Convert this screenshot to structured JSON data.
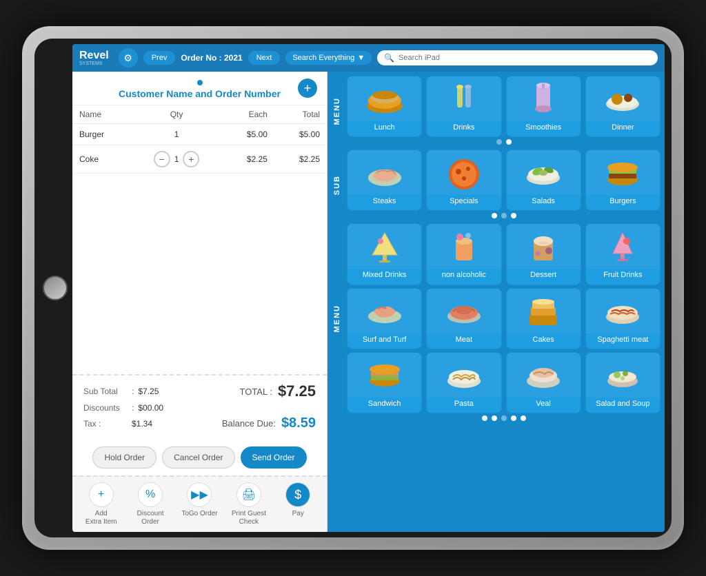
{
  "app": {
    "title": "Revel Systems POS"
  },
  "header": {
    "logo": "Revel",
    "logo_sub": "SYSTEMS",
    "gear_icon": "⚙",
    "prev_label": "Prev",
    "order_label": "Order No : 2021",
    "next_label": "Next",
    "search_dropdown": "Search Everything",
    "search_placeholder": "Search iPad"
  },
  "order": {
    "title": "Customer Name and Order Number",
    "add_button": "+",
    "table_headers": [
      "Name",
      "Qty",
      "Each",
      "Total"
    ],
    "items": [
      {
        "name": "Burger",
        "qty": "1",
        "each": "$5.00",
        "total": "$5.00"
      },
      {
        "name": "Coke",
        "qty": "1",
        "each": "$2.25",
        "total": "$2.25"
      }
    ],
    "subtotal_label": "Sub Total",
    "subtotal_value": "$7.25",
    "discounts_label": "Discounts",
    "discounts_value": "$00.00",
    "tax_label": "Tax :",
    "tax_value": "$1.34",
    "total_label": "TOTAL :",
    "total_value": "$7.25",
    "balance_label": "Balance Due:",
    "balance_value": "$8.59",
    "hold_label": "Hold Order",
    "cancel_label": "Cancel Order",
    "send_label": "Send Order"
  },
  "toolbar": {
    "items": [
      {
        "icon": "+",
        "label": "Add\nExtra Item"
      },
      {
        "icon": "%",
        "label": "Discount\nOrder"
      },
      {
        "icon": "▸▸",
        "label": "ToGo Order"
      },
      {
        "icon": "🖨",
        "label": "Print Guest\nCheck"
      },
      {
        "icon": "$",
        "label": "Pay",
        "is_pay": true
      }
    ]
  },
  "menu": {
    "sections": [
      {
        "label": "MENU",
        "items": [
          {
            "name": "Lunch",
            "emoji": "🍔"
          },
          {
            "name": "Drinks",
            "emoji": "🍺"
          },
          {
            "name": "Smoothies",
            "emoji": "🧋"
          },
          {
            "name": "Dinner",
            "emoji": "🍽"
          }
        ],
        "dots": [
          false,
          true
        ]
      },
      {
        "label": "SUB",
        "items": [
          {
            "name": "Steaks",
            "emoji": "🥩"
          },
          {
            "name": "Specials",
            "emoji": "🍕"
          },
          {
            "name": "Salads",
            "emoji": "🥗"
          },
          {
            "name": "Burgers",
            "emoji": "🍔"
          }
        ],
        "dots": [
          true,
          false,
          true
        ]
      },
      {
        "label": "",
        "items": [
          {
            "name": "Mixed Drinks",
            "emoji": "🍸"
          },
          {
            "name": "non alcoholic",
            "emoji": "🧁"
          },
          {
            "name": "Dessert",
            "emoji": "🍦"
          },
          {
            "name": "Fruit Drinks",
            "emoji": "🍹"
          }
        ],
        "dots": null
      },
      {
        "label": "MENU",
        "items": [
          {
            "name": "Surf and Turf",
            "emoji": "🦞"
          },
          {
            "name": "Meat",
            "emoji": "🥩"
          },
          {
            "name": "Cakes",
            "emoji": "🎂"
          },
          {
            "name": "Spaghetti meat",
            "emoji": "🍝"
          }
        ],
        "dots": null
      },
      {
        "label": "",
        "items": [
          {
            "name": "Sandwich",
            "emoji": "🥪"
          },
          {
            "name": "Pasta",
            "emoji": "🍝"
          },
          {
            "name": "Veal",
            "emoji": "🍖"
          },
          {
            "name": "Salad and Soup",
            "emoji": "🥗"
          }
        ],
        "dots": [
          true,
          true,
          false,
          true,
          true
        ]
      }
    ]
  }
}
